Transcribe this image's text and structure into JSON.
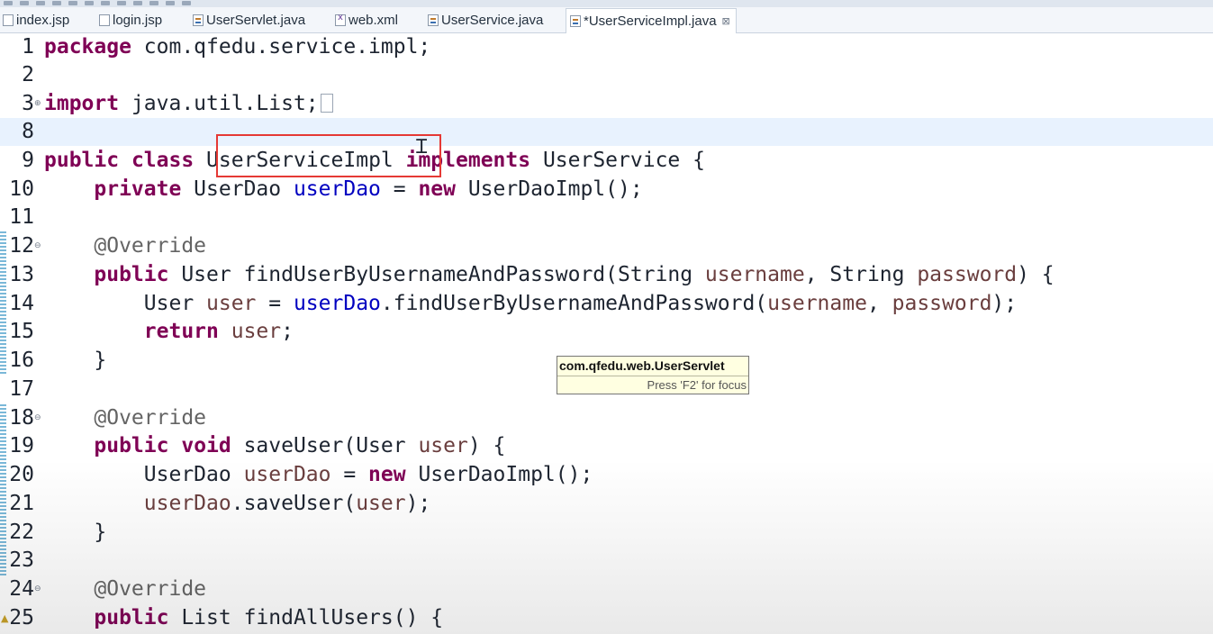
{
  "tabs": [
    {
      "label": "index.jsp",
      "icon": "jsp-file-icon",
      "active": false
    },
    {
      "label": "login.jsp",
      "icon": "jsp-file-icon",
      "active": false
    },
    {
      "label": "UserServlet.java",
      "icon": "java-file-icon",
      "active": false
    },
    {
      "label": "web.xml",
      "icon": "xml-file-icon",
      "active": false
    },
    {
      "label": "UserService.java",
      "icon": "java-file-icon",
      "active": false
    },
    {
      "label": "*UserServiceImpl.java",
      "icon": "java-file-icon",
      "active": true,
      "close": "⊠"
    }
  ],
  "lines": [
    {
      "n": "1",
      "code": "package com.qfedu.service.impl;"
    },
    {
      "n": "2",
      "code": ""
    },
    {
      "n": "3",
      "code": "import java.util.List;",
      "fold": "⊕"
    },
    {
      "n": "8",
      "code": ""
    },
    {
      "n": "9",
      "code": "public class UserServiceImpl implements UserService {"
    },
    {
      "n": "10",
      "code": "    private UserDao userDao = new UserDaoImpl();"
    },
    {
      "n": "11",
      "code": ""
    },
    {
      "n": "12",
      "code": "    @Override",
      "fold": "⊖"
    },
    {
      "n": "13",
      "code": "    public User findUserByUsernameAndPassword(String username, String password) {"
    },
    {
      "n": "14",
      "code": "        User user = userDao.findUserByUsernameAndPassword(username, password);"
    },
    {
      "n": "15",
      "code": "        return user;"
    },
    {
      "n": "16",
      "code": "    }"
    },
    {
      "n": "17",
      "code": ""
    },
    {
      "n": "18",
      "code": "    @Override",
      "fold": "⊖"
    },
    {
      "n": "19",
      "code": "    public void saveUser(User user) {"
    },
    {
      "n": "20",
      "code": "        UserDao userDao = new UserDaoImpl();"
    },
    {
      "n": "21",
      "code": "        userDao.saveUser(user);"
    },
    {
      "n": "22",
      "code": "    }"
    },
    {
      "n": "23",
      "code": ""
    },
    {
      "n": "24",
      "code": "    @Override",
      "fold": "⊖"
    },
    {
      "n": "25",
      "code": "    public List findAllUsers() {"
    }
  ],
  "tooltip": {
    "title": "com.qfedu.web.UserServlet",
    "hint": "Press 'F2' for focus"
  },
  "colors": {
    "keyword": "#7f0055",
    "field": "#0000c0",
    "local": "#6a3e3e",
    "annotation": "#646464",
    "highlight_box": "#e53935",
    "current_line": "#e8f2fe",
    "tooltip_bg": "#ffffe1"
  }
}
